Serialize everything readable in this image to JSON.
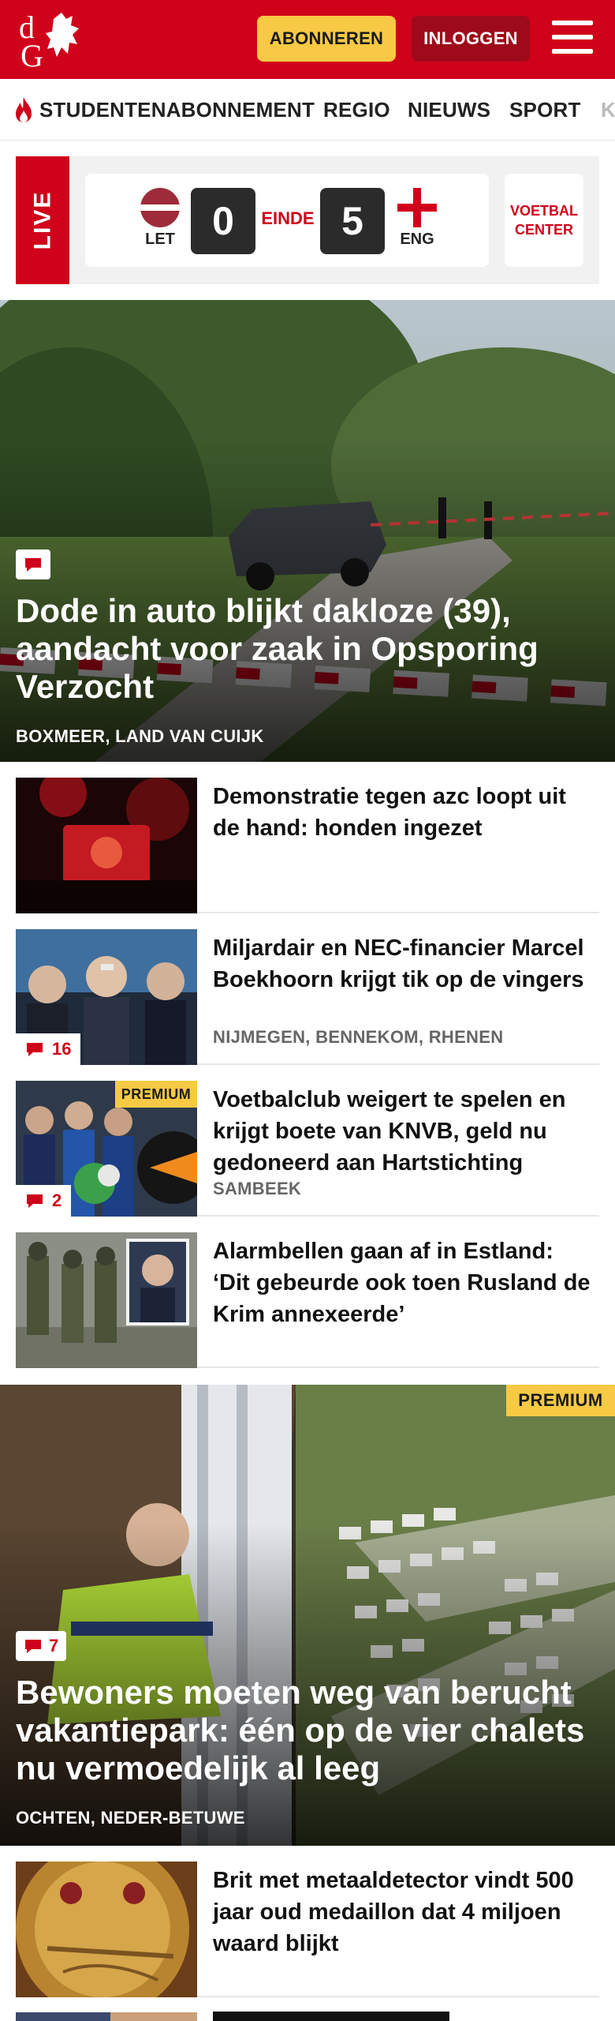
{
  "header": {
    "logo_text": "dG",
    "subscribe_label": "ABONNEREN",
    "login_label": "INLOGGEN"
  },
  "nav": {
    "items": [
      "STUDENTENABONNEMENT",
      "REGIO",
      "NIEUWS",
      "SPORT",
      "K"
    ]
  },
  "live": {
    "label": "LIVE",
    "home_team": "LET",
    "away_team": "ENG",
    "home_score": "0",
    "away_score": "5",
    "status": "EINDE",
    "center_label": "VOETBAL CENTER"
  },
  "hero1": {
    "title": "Dode in auto blijkt dakloze (39), aandacht voor zaak in Opsporing Verzocht",
    "location": "BOXMEER, LAND VAN CUIJK"
  },
  "articles": [
    {
      "title": "Demonstratie tegen azc loopt uit de hand: honden ingezet",
      "location": "",
      "comments": "",
      "premium": ""
    },
    {
      "title": "Miljardair en NEC-financier Marcel Boekhoorn krijgt tik op de vingers",
      "location": "NIJMEGEN, BENNEKOM, RHENEN",
      "comments": "16",
      "premium": ""
    },
    {
      "title": "Voetbalclub weigert te spelen en krijgt boete van KNVB, geld nu gedoneerd aan Hartstichting",
      "location": "SAMBEEK",
      "comments": "2",
      "premium": "PREMIUM"
    },
    {
      "title": "Alarmbellen gaan af in Estland: ‘Dit gebeurde ook toen Rusland de Krim annexeerde’",
      "location": "",
      "comments": "",
      "premium": ""
    }
  ],
  "hero2": {
    "title": "Bewoners moeten weg van berucht vakantiepark: één op de vier chalets nu vermoedelijk al leeg",
    "location": "OCHTEN, NEDER-BETUWE",
    "comments": "7",
    "premium": "PREMIUM"
  },
  "articles2": [
    {
      "title": "Brit met metaaldetector vindt 500 jaar oud medaillon dat 4 miljoen waard blijkt"
    }
  ],
  "colors": {
    "brand_red": "#d0021b",
    "subscribe_yellow": "#f7c944",
    "login_dark_red": "#9e0a1a"
  }
}
